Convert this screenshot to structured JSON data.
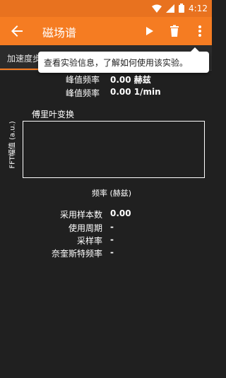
{
  "status_bar": {
    "time": "4:12"
  },
  "toolbar": {
    "title": "磁场谱"
  },
  "tabs": {
    "active_label": "加速度步"
  },
  "tooltip": {
    "text": "查看实验信息，了解如何使用该实验。"
  },
  "stats": [
    {
      "label": "峰值频率",
      "value": "0.00 赫兹"
    },
    {
      "label": "峰值频率",
      "value": "0.00 1/min"
    }
  ],
  "fft": {
    "title": "傅里叶变换",
    "ylabel": "FFT幅值 (a.u.)",
    "xlabel": "频率 (赫兹)"
  },
  "details": [
    {
      "label": "采用样本数",
      "value": "0.00"
    },
    {
      "label": "使用周期",
      "value": "-"
    },
    {
      "label": "采样率",
      "value": "-"
    },
    {
      "label": "奈奎斯特频率",
      "value": "-"
    }
  ],
  "colors": {
    "toolbar": "#f57c22",
    "status_bar": "#e8721f",
    "background": "#202020"
  }
}
